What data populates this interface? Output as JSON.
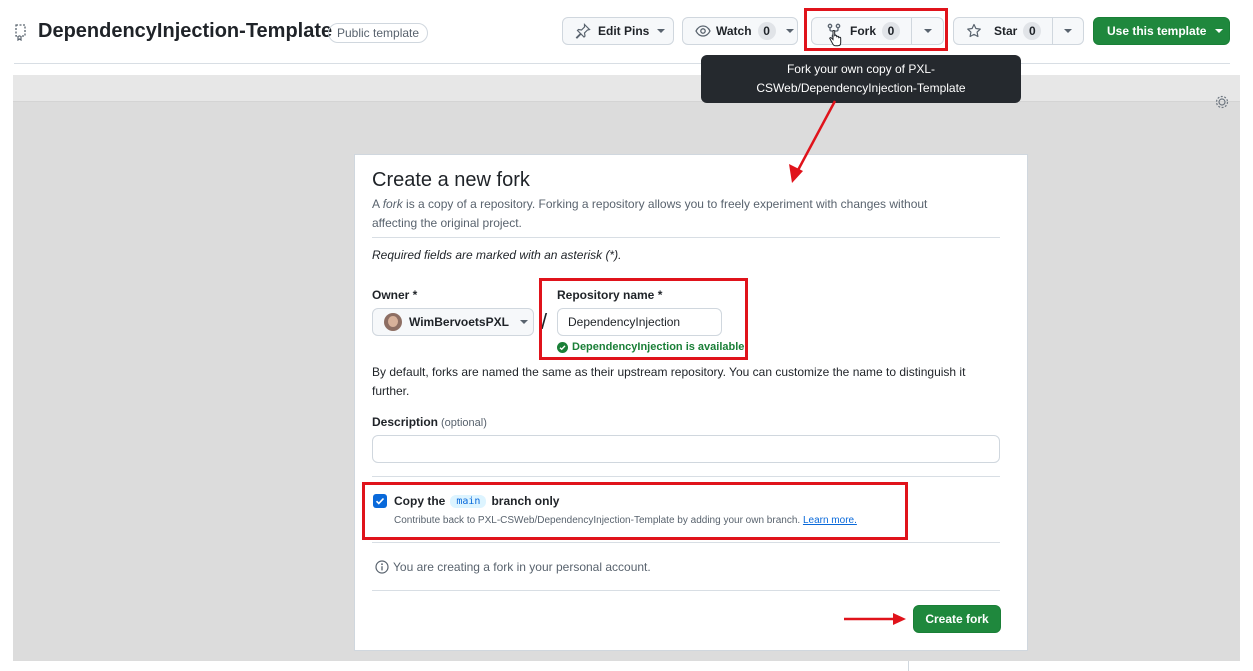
{
  "header": {
    "repo_title": "DependencyInjection-Template",
    "visibility_badge": "Public template",
    "repo_icon": "repo-template-icon",
    "edit_pins_label": "Edit Pins",
    "watch_label": "Watch",
    "watch_count": "0",
    "fork_label": "Fork",
    "fork_count": "0",
    "star_label": "Star",
    "star_count": "0",
    "use_template_label": "Use this template"
  },
  "tooltip": {
    "text": "Fork your own copy of PXL-CSWeb/DependencyInjection-Template"
  },
  "dialog": {
    "title": "Create a new fork",
    "subtitle_prefix": "A ",
    "subtitle_em": "fork",
    "subtitle_rest": " is a copy of a repository. Forking a repository allows you to freely experiment with changes without affecting the original project.",
    "required_note": "Required fields are marked with an asterisk (*).",
    "owner_label": "Owner *",
    "owner_value": "WimBervoetsPXL",
    "repo_name_label": "Repository name *",
    "repo_name_value": "DependencyInjection",
    "availability": "DependencyInjection is available.",
    "default_note": "By default, forks are named the same as their upstream repository. You can customize the name to distinguish it further.",
    "description_label": "Description",
    "description_optional": "(optional)",
    "description_value": "",
    "copy_branch_prefix": "Copy the",
    "copy_branch_name": "main",
    "copy_branch_suffix": "branch only",
    "copy_branch_checked": true,
    "copy_help": "Contribute back to PXL-CSWeb/DependencyInjection-Template by adding your own branch.",
    "learn_more": "Learn more.",
    "info_text": "You are creating a fork in your personal account.",
    "create_button": "Create fork"
  },
  "colors": {
    "accent_green": "#1f883d",
    "annotation_red": "#e0131b",
    "link_blue": "#0969da",
    "success_green": "#1a7f37"
  }
}
